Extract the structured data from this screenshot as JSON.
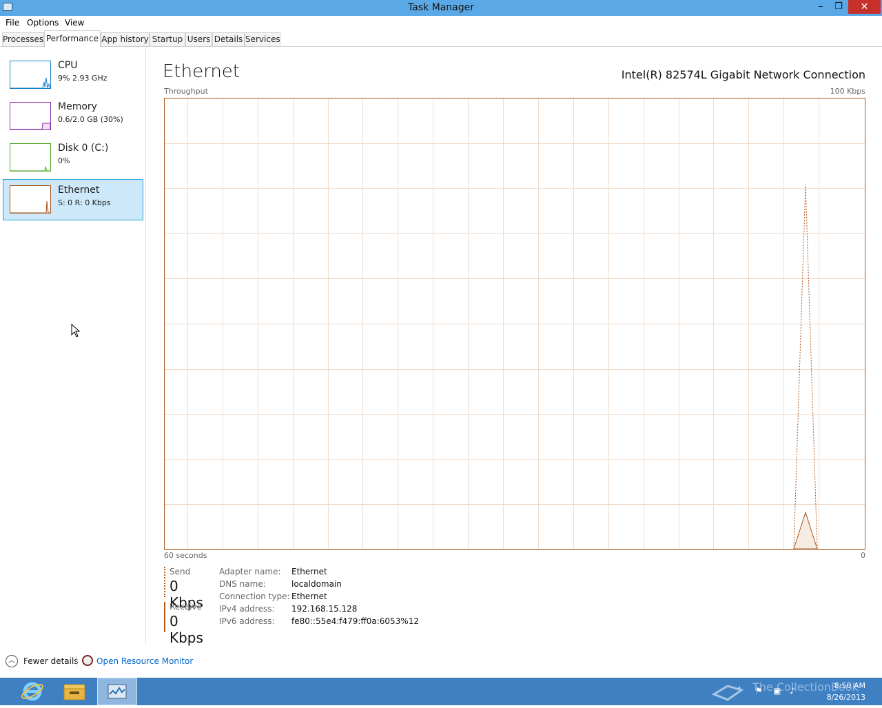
{
  "window": {
    "title": "Task Manager",
    "controls": {
      "minimize": "–",
      "maximize": "❐",
      "close": "✕"
    }
  },
  "menu": [
    "File",
    "Options",
    "View"
  ],
  "tabs": [
    "Processes",
    "Performance",
    "App history",
    "Startup",
    "Users",
    "Details",
    "Services"
  ],
  "active_tab": "Performance",
  "sidebar": {
    "items": [
      {
        "title": "CPU",
        "subtitle": "9% 2.93 GHz",
        "color": "#1a7fc9"
      },
      {
        "title": "Memory",
        "subtitle": "0.6/2.0 GB (30%)",
        "color": "#8b2fa8"
      },
      {
        "title": "Disk 0 (C:)",
        "subtitle": "0%",
        "color": "#4da21f"
      },
      {
        "title": "Ethernet",
        "subtitle": "S: 0 R: 0 Kbps",
        "color": "#a7551b"
      }
    ],
    "selected": "Ethernet"
  },
  "main": {
    "title": "Ethernet",
    "adapter_description": "Intel(R) 82574L Gigabit Network Connection",
    "graph_label": "Throughput",
    "graph_max_label": "100 Kbps",
    "time_label": "60 seconds",
    "zero_label": "0",
    "send_label": "Send",
    "send_value": "0 Kbps",
    "receive_label": "Receive",
    "receive_value": "0 Kbps",
    "properties": [
      {
        "key": "Adapter name:",
        "value": "Ethernet"
      },
      {
        "key": "DNS name:",
        "value": "localdomain"
      },
      {
        "key": "Connection type:",
        "value": "Ethernet"
      },
      {
        "key": "IPv4 address:",
        "value": "192.168.15.128"
      },
      {
        "key": "IPv6 address:",
        "value": "fe80::55e4:f479:ff0a:6053%12"
      }
    ],
    "accent_color": "#a7551b",
    "grid_color": "#f0dccc"
  },
  "footer": {
    "fewer_details": "Fewer details",
    "open_resource_monitor": "Open Resource Monitor"
  },
  "taskbar": {
    "apps": [
      "ie-icon",
      "file-explorer-icon",
      "task-manager-icon"
    ],
    "watermark": "The CollectionBook",
    "time": "8:50 AM",
    "date": "8/26/2013"
  }
}
